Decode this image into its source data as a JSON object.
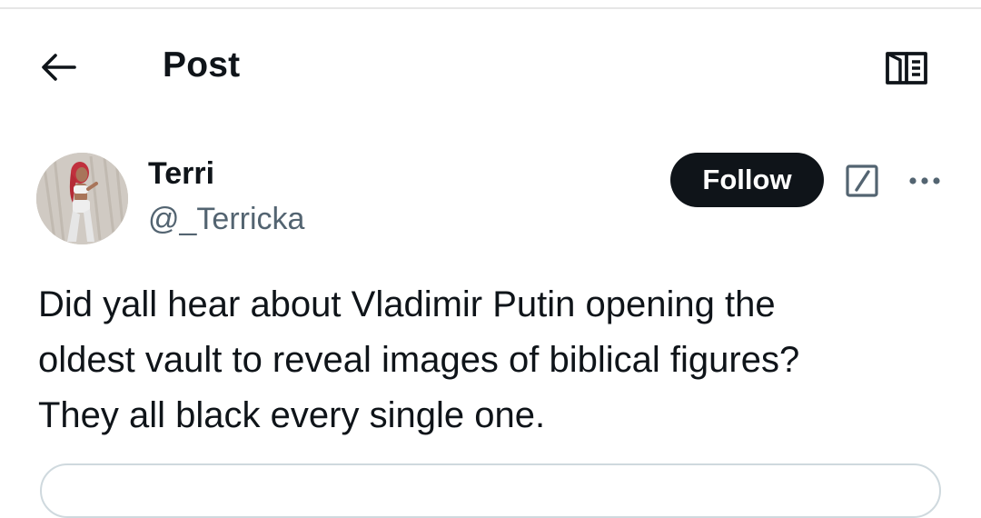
{
  "header": {
    "title": "Post",
    "back_icon": "arrow-left-icon",
    "reader_icon": "reader-mode-icon"
  },
  "post": {
    "author": {
      "display_name": "Terri",
      "handle": "@_Terricka"
    },
    "follow_label": "Follow",
    "text": "Did yall hear about Vladimir  Putin opening the\noldest vault to reveal images of biblical figures?\nThey all black every single one."
  },
  "colors": {
    "text_primary": "#0f1419",
    "text_secondary": "#536471",
    "follow_bg": "#0f1419",
    "border": "#cfd9de"
  }
}
